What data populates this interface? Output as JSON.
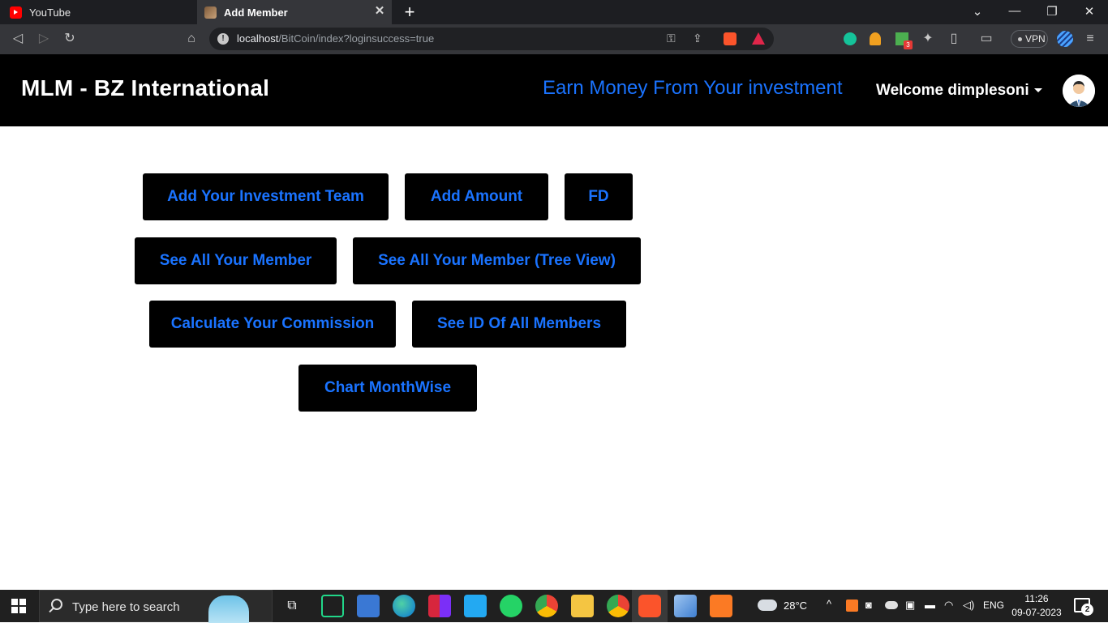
{
  "browser": {
    "tabs": [
      {
        "label": "YouTube"
      },
      {
        "label": "Add Member"
      }
    ],
    "address": {
      "host": "localhost",
      "path": "/BitCoin/index?loginsuccess=true"
    },
    "vpn_label": "VPN",
    "extension_badge": "3"
  },
  "header": {
    "brand": "MLM - BZ International",
    "tagline": "Earn Money From Your investment",
    "welcome": "Welcome dimplesoni"
  },
  "actions": {
    "add_team": "Add Your Investment Team",
    "add_amount": "Add Amount",
    "fd": "FD",
    "see_members": "See All Your Member",
    "see_members_tree": "See All Your Member (Tree View)",
    "calc_commission": "Calculate Your Commission",
    "see_ids": "See ID Of All Members",
    "chart_monthwise": "Chart MonthWise"
  },
  "taskbar": {
    "search_placeholder": "Type here to search",
    "weather": "28°C",
    "language": "ENG",
    "time": "11:26",
    "date": "09-07-2023",
    "notification_count": "2"
  },
  "colors": {
    "accent_blue": "#1a73ff",
    "header_bg": "#000000",
    "button_bg": "#000000"
  }
}
